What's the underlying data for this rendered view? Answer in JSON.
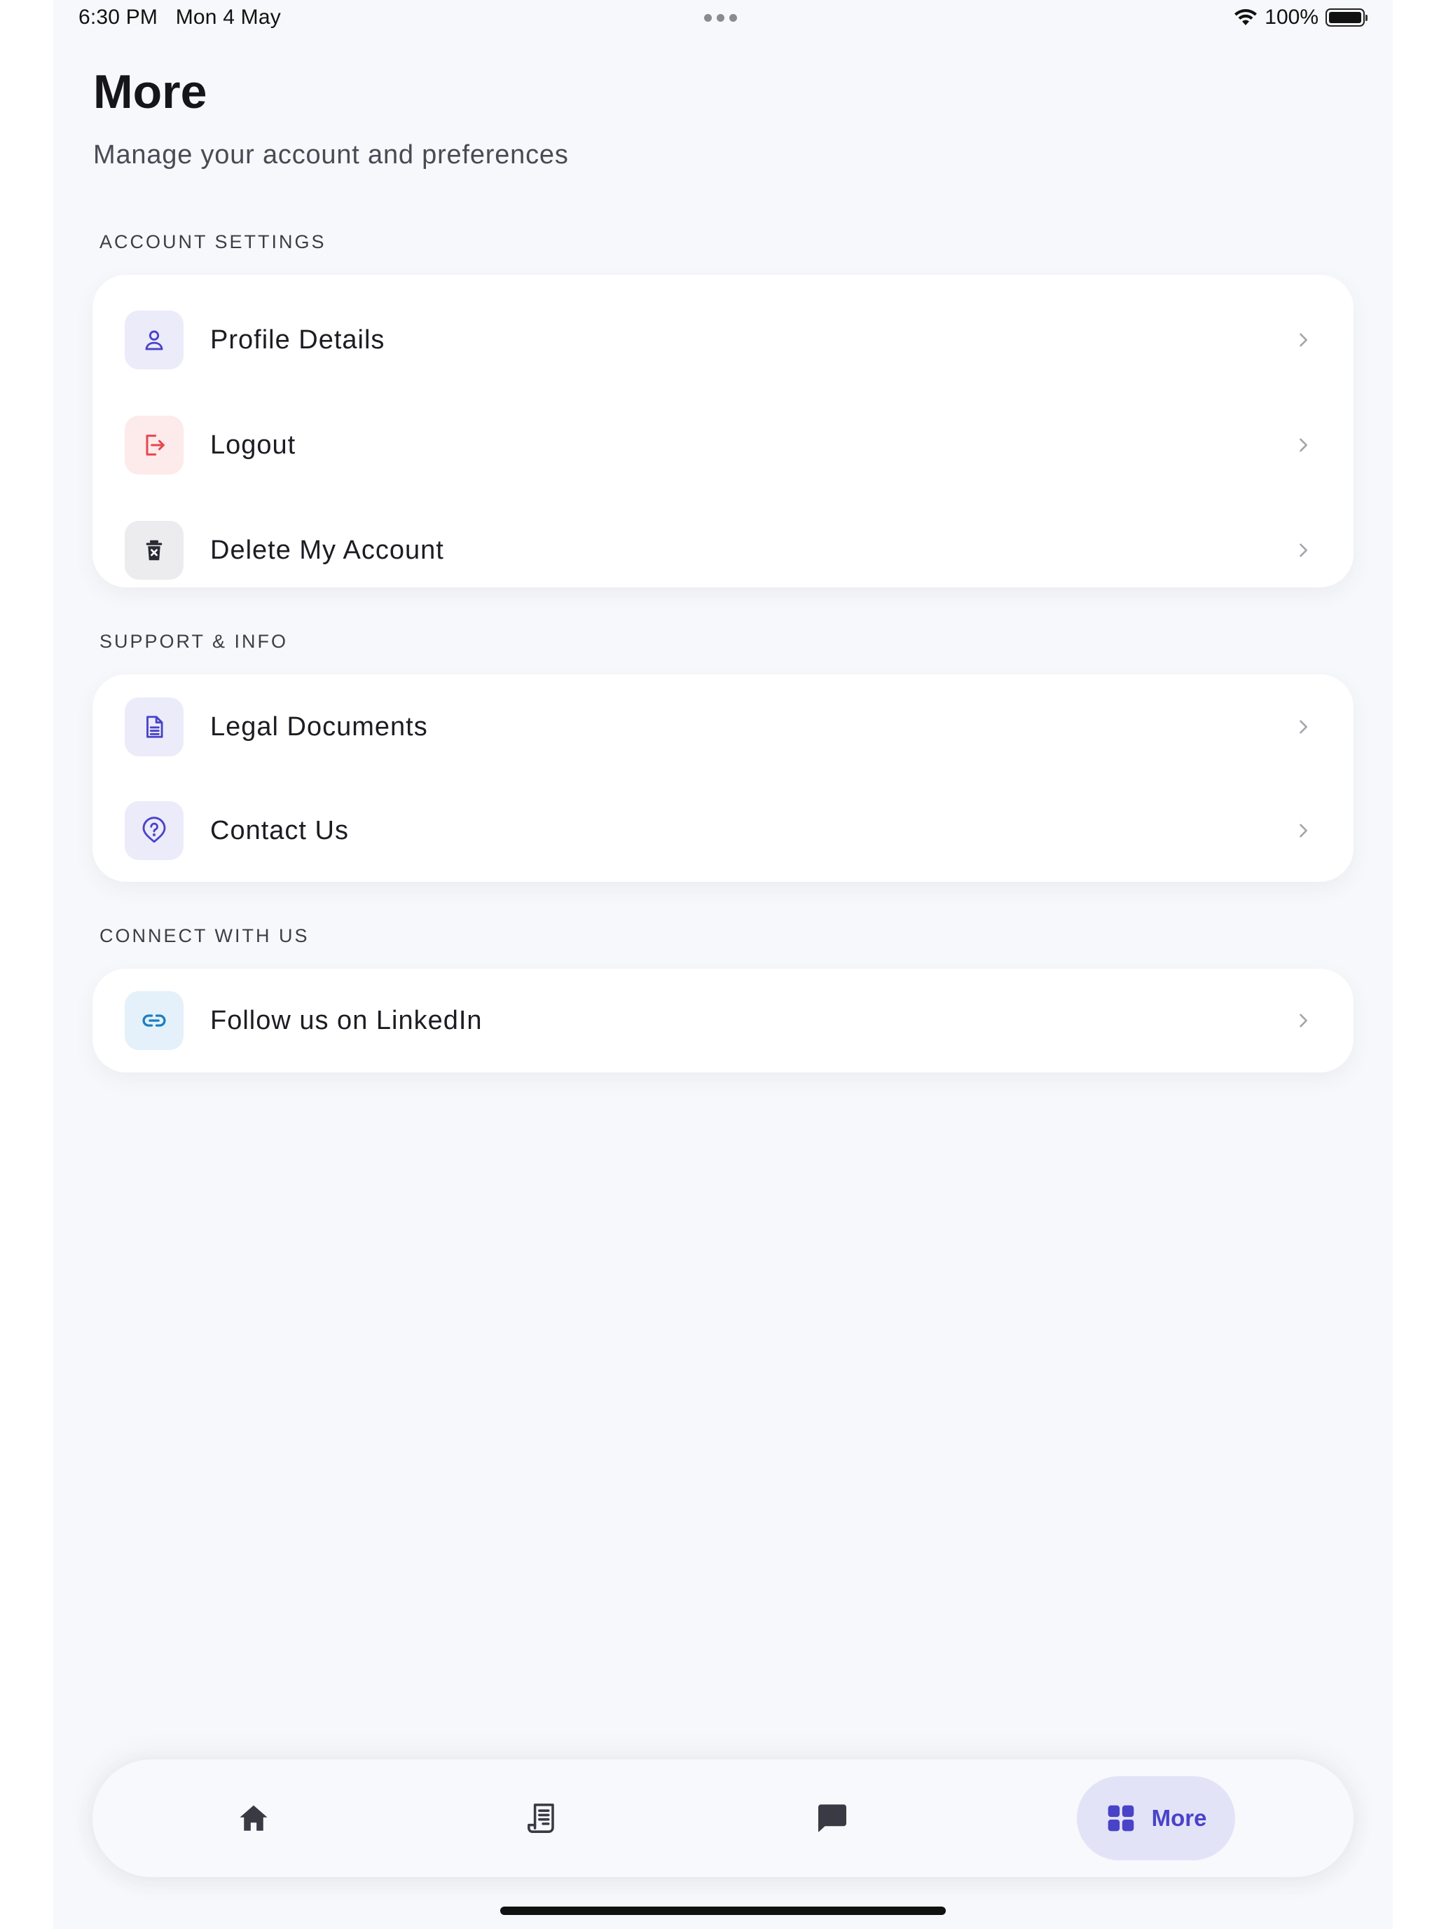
{
  "status_bar": {
    "time": "6:30 PM",
    "date": "Mon 4 May",
    "battery_text": "100%"
  },
  "header": {
    "title": "More",
    "subtitle": "Manage your account and preferences"
  },
  "sections": {
    "account": {
      "label": "ACCOUNT SETTINGS",
      "items": [
        {
          "label": "Profile Details",
          "icon": "user-icon"
        },
        {
          "label": "Logout",
          "icon": "logout-icon"
        },
        {
          "label": "Delete My Account",
          "icon": "trash-icon"
        }
      ]
    },
    "support": {
      "label": "SUPPORT & INFO",
      "items": [
        {
          "label": "Legal Documents",
          "icon": "document-icon"
        },
        {
          "label": "Contact Us",
          "icon": "help-icon"
        }
      ]
    },
    "connect": {
      "label": "CONNECT WITH US",
      "items": [
        {
          "label": "Follow us on LinkedIn",
          "icon": "link-icon"
        }
      ]
    }
  },
  "tabbar": {
    "tabs": [
      {
        "icon": "home-icon",
        "label": ""
      },
      {
        "icon": "receipt-icon",
        "label": ""
      },
      {
        "icon": "chat-icon",
        "label": ""
      },
      {
        "icon": "grid-icon",
        "label": "More",
        "active": true
      }
    ]
  },
  "colors": {
    "accent": "#4943c8",
    "accent_bg": "#e3e3f8",
    "danger": "#e5484d",
    "danger_bg": "#fdeaea",
    "neutral_bg": "#ececef",
    "link_blue": "#1a7fc1",
    "link_bg": "#e4f1fa",
    "background": "#f7f8fb"
  }
}
